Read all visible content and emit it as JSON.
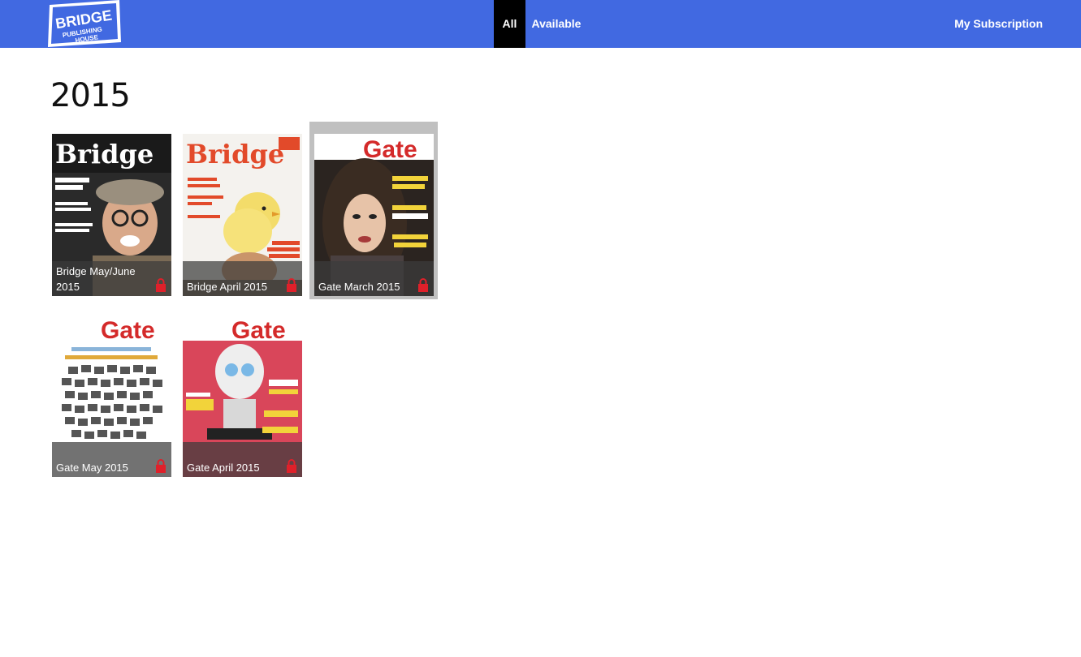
{
  "header": {
    "logo_text": "BRIDGE PUBLISHING HOUSE",
    "tabs": [
      {
        "label": "All"
      },
      {
        "label": "Available"
      }
    ],
    "subscription_label": "My Subscription",
    "accent": "#4169e1"
  },
  "main": {
    "year": "2015",
    "issues": [
      {
        "title": "Bridge May/June 2015",
        "masthead": "Bridge",
        "locked": true
      },
      {
        "title": "Bridge April 2015",
        "masthead": "Bridge",
        "locked": true
      },
      {
        "title": "Gate March 2015",
        "masthead": "Gate",
        "locked": true,
        "selected": true
      },
      {
        "title": "Gate May 2015",
        "masthead": "Gate",
        "locked": true
      },
      {
        "title": "Gate April 2015",
        "masthead": "Gate",
        "locked": true
      }
    ]
  },
  "colors": {
    "lock": "#e0202a",
    "selection": "#c0c0c0",
    "caption_overlay": "rgba(60,60,60,0.72)"
  }
}
